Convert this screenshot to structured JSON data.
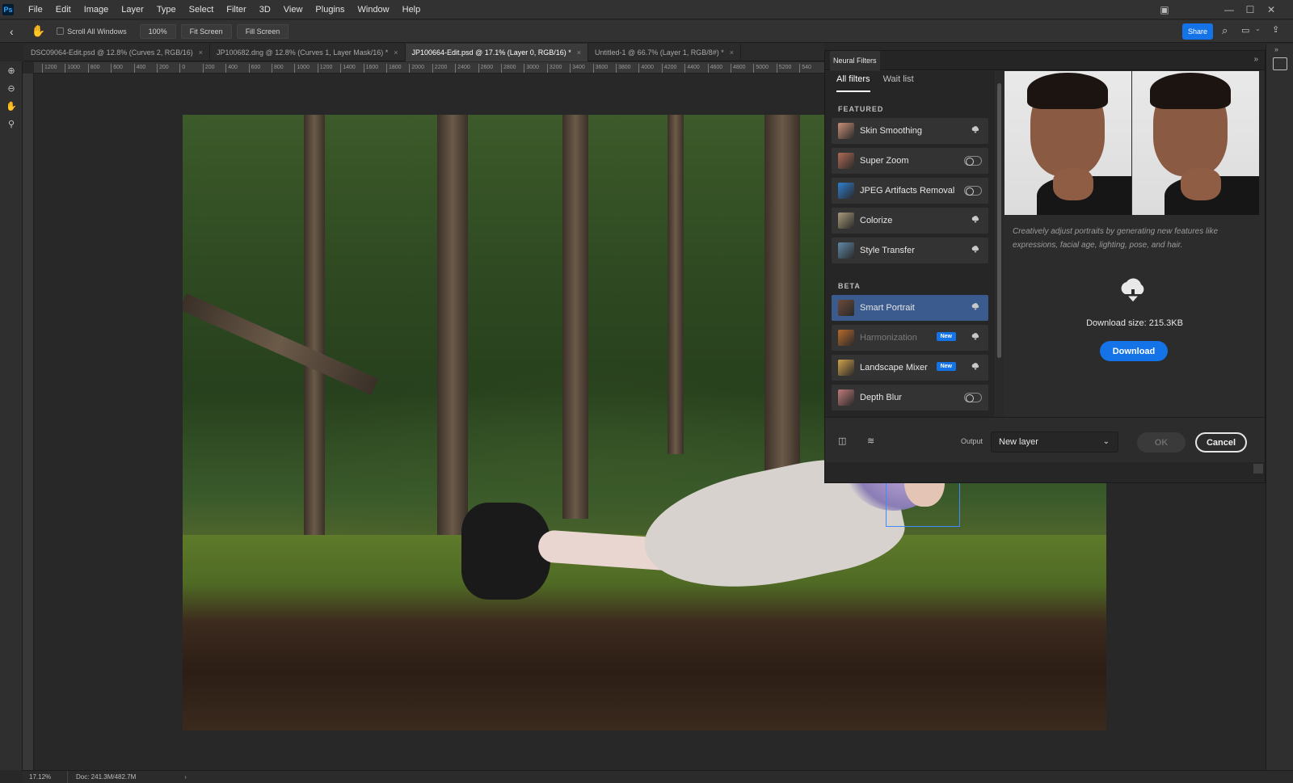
{
  "app": {
    "logo": "Ps"
  },
  "menu": [
    "File",
    "Edit",
    "Image",
    "Layer",
    "Type",
    "Select",
    "Filter",
    "3D",
    "View",
    "Plugins",
    "Window",
    "Help"
  ],
  "options": {
    "scroll_all_windows": "Scroll All Windows",
    "zoom_100": "100%",
    "fit_screen": "Fit Screen",
    "fill_screen": "Fill Screen",
    "share": "Share"
  },
  "tabs": [
    {
      "label": "DSC09064-Edit.psd @ 12.8% (Curves 2, RGB/16)",
      "active": false
    },
    {
      "label": "JP100682.dng @ 12.8% (Curves 1, Layer Mask/16) *",
      "active": false
    },
    {
      "label": "JP100664-Edit.psd @ 17.1% (Layer 0, RGB/16) *",
      "active": true
    },
    {
      "label": "Untitled-1 @ 66.7% (Layer 1, RGB/8#) *",
      "active": false
    }
  ],
  "ruler": [
    "1200",
    "1000",
    "800",
    "600",
    "400",
    "200",
    "0",
    "200",
    "400",
    "600",
    "800",
    "1000",
    "1200",
    "1400",
    "1600",
    "1800",
    "2000",
    "2200",
    "2400",
    "2600",
    "2800",
    "3000",
    "3200",
    "3400",
    "3600",
    "3800",
    "4000",
    "4200",
    "4400",
    "4600",
    "4800",
    "5000",
    "5200",
    "540"
  ],
  "neural_filters": {
    "panel_title": "Neural Filters",
    "tabs": {
      "all": "All filters",
      "wait": "Wait list"
    },
    "featured_label": "FEATURED",
    "beta_label": "BETA",
    "featured": [
      {
        "label": "Skin Smoothing",
        "control": "cloud",
        "thumb": "#c98f77"
      },
      {
        "label": "Super Zoom",
        "control": "toggle",
        "thumb": "#b06a55"
      },
      {
        "label": "JPEG Artifacts Removal",
        "control": "toggle",
        "thumb": "#2f7fd0"
      },
      {
        "label": "Colorize",
        "control": "cloud",
        "thumb": "#a99a7a"
      },
      {
        "label": "Style Transfer",
        "control": "cloud",
        "thumb": "#5f8aa8"
      }
    ],
    "beta": [
      {
        "label": "Smart Portrait",
        "control": "cloud",
        "thumb": "#6d4a3b",
        "selected": true
      },
      {
        "label": "Harmonization",
        "control": "cloud",
        "thumb": "#b86a2a",
        "badge": "New",
        "dim": true
      },
      {
        "label": "Landscape Mixer",
        "control": "cloud",
        "thumb": "#d0a24a",
        "badge": "New"
      },
      {
        "label": "Depth Blur",
        "control": "toggle",
        "thumb": "#c07a7a"
      }
    ],
    "description": "Creatively adjust portraits by generating new features like expressions, facial age, lighting, pose, and hair.",
    "download_size": "Download size: 215.3KB",
    "download_label": "Download",
    "output_label": "Output",
    "output_value": "New layer",
    "ok_label": "OK",
    "cancel_label": "Cancel"
  },
  "status": {
    "zoom": "17.12%",
    "doc": "Doc: 241.3M/482.7M"
  },
  "colors": {
    "accent": "#1473e6",
    "selected": "#3b5a8e",
    "face_box": "#3d8bff"
  }
}
